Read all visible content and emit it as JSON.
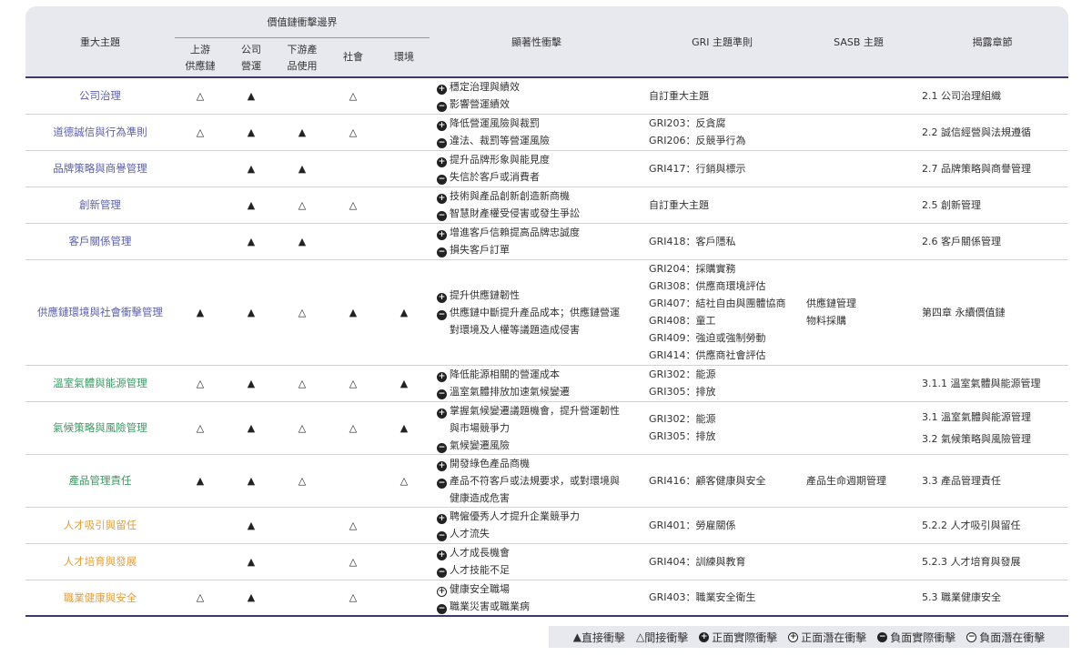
{
  "headers": {
    "topic": "重大主題",
    "value_chain": "價值鏈衝擊邊界",
    "upstream": [
      "上游",
      "供應鏈"
    ],
    "company": [
      "公司",
      "營運"
    ],
    "downstream": [
      "下游產",
      "品使用"
    ],
    "society": "社會",
    "environment": "環境",
    "impact": "顯著性衝擊",
    "gri": "GRI 主題準則",
    "sasb": "SASB 主題",
    "chapter": "揭露章節"
  },
  "colors": {
    "governance": "#5b5fa8",
    "environment": "#3a9a63",
    "social": "#e0a040",
    "rule": "#3a3a6a"
  },
  "rows": [
    {
      "topic": "公司治理",
      "cat": "gov",
      "up": "△",
      "co": "▲",
      "down": "",
      "soc": "△",
      "env": "",
      "impacts": [
        {
          "s": "+",
          "t": "穩定治理與績效"
        },
        {
          "s": "-",
          "t": "影響營運績效"
        }
      ],
      "gri": [
        "自訂重大主題"
      ],
      "sasb": [],
      "chapter": [
        "2.1 公司治理組織"
      ]
    },
    {
      "topic": "道德誠信與行為準則",
      "cat": "gov",
      "up": "△",
      "co": "▲",
      "down": "▲",
      "soc": "△",
      "env": "",
      "impacts": [
        {
          "s": "+",
          "t": "降低營運風險與裁罰"
        },
        {
          "s": "-",
          "t": "違法、裁罰等營運風險"
        }
      ],
      "gri": [
        "GRI203：反貪腐",
        "GRI206：反競爭行為"
      ],
      "sasb": [],
      "chapter": [
        "2.2 誠信經營與法規遵循"
      ]
    },
    {
      "topic": "品牌策略與商譽管理",
      "cat": "gov",
      "up": "",
      "co": "▲",
      "down": "▲",
      "soc": "",
      "env": "",
      "impacts": [
        {
          "s": "+",
          "t": "提升品牌形象與能見度"
        },
        {
          "s": "-",
          "t": "失信於客戶或消費者"
        }
      ],
      "gri": [
        "GRI417：行銷與標示"
      ],
      "sasb": [],
      "chapter": [
        "2.7 品牌策略與商譽管理"
      ]
    },
    {
      "topic": "創新管理",
      "cat": "gov",
      "up": "",
      "co": "▲",
      "down": "△",
      "soc": "△",
      "env": "",
      "impacts": [
        {
          "s": "+",
          "t": "技術與產品創新創造新商機"
        },
        {
          "s": "-",
          "t": "智慧財產權受侵害或發生爭訟"
        }
      ],
      "gri": [
        "自訂重大主題"
      ],
      "sasb": [],
      "chapter": [
        "2.5 創新管理"
      ]
    },
    {
      "topic": "客戶關係管理",
      "cat": "gov",
      "up": "",
      "co": "▲",
      "down": "▲",
      "soc": "",
      "env": "",
      "impacts": [
        {
          "s": "+",
          "t": "增進客戶信賴提高品牌忠誠度"
        },
        {
          "s": "-",
          "t": "損失客戶訂單"
        }
      ],
      "gri": [
        "GRI418：客戶隱私"
      ],
      "sasb": [],
      "chapter": [
        "2.6 客戶關係管理"
      ]
    },
    {
      "topic": "供應鏈環境與社會衝擊管理",
      "cat": "gov",
      "up": "▲",
      "co": "▲",
      "down": "△",
      "soc": "▲",
      "env": "▲",
      "impacts": [
        {
          "s": "+",
          "t": "提升供應鏈韌性"
        },
        {
          "s": "-",
          "t": "供應鏈中斷提升產品成本；供應鏈營運"
        },
        {
          "s": "",
          "t": "對環境及人權等議題造成侵害"
        }
      ],
      "gri": [
        "GRI204：採購實務",
        "GRI308：供應商環境評估",
        "GRI407：結社自由與團體協商",
        "GRI408：童工",
        "GRI409：強迫或強制勞動",
        "GRI414：供應商社會評估"
      ],
      "sasb": [
        "供應鏈管理",
        "物料採購"
      ],
      "chapter": [
        "第四章 永續價值鏈"
      ]
    },
    {
      "topic": "溫室氣體與能源管理",
      "cat": "env",
      "up": "△",
      "co": "▲",
      "down": "△",
      "soc": "△",
      "env": "▲",
      "impacts": [
        {
          "s": "+",
          "t": "降低能源相關的營運成本"
        },
        {
          "s": "-",
          "t": "溫室氣體排放加速氣候變遷"
        }
      ],
      "gri": [
        "GRI302：能源",
        "GRI305：排放"
      ],
      "sasb": [],
      "chapter": [
        "3.1.1 溫室氣體與能源管理"
      ]
    },
    {
      "topic": "氣候策略與風險管理",
      "cat": "env",
      "up": "△",
      "co": "▲",
      "down": "△",
      "soc": "△",
      "env": "▲",
      "impacts": [
        {
          "s": "+",
          "t": "掌握氣候變遷議題機會，提升營運韌性"
        },
        {
          "s": "",
          "t": "與市場競爭力"
        },
        {
          "s": "-",
          "t": "氣候變遷風險"
        }
      ],
      "gri": [
        "GRI302：能源",
        "GRI305：排放"
      ],
      "sasb": [],
      "chapter": [
        "3.1 溫室氣體與能源管理",
        "3.2 氣候策略與風險管理"
      ]
    },
    {
      "topic": "產品管理責任",
      "cat": "env",
      "up": "▲",
      "co": "▲",
      "down": "△",
      "soc": "",
      "env": "△",
      "impacts": [
        {
          "s": "+",
          "t": "開發綠色產品商機"
        },
        {
          "s": "-",
          "t": "產品不符客戶或法規要求，或對環境與"
        },
        {
          "s": "",
          "t": "健康造成危害"
        }
      ],
      "gri": [
        "GRI416：顧客健康與安全"
      ],
      "sasb": [
        "產品生命週期管理"
      ],
      "chapter": [
        "3.3 產品管理責任"
      ]
    },
    {
      "topic": "人才吸引與留任",
      "cat": "soc",
      "up": "",
      "co": "▲",
      "down": "",
      "soc": "△",
      "env": "",
      "impacts": [
        {
          "s": "+",
          "t": "聘僱優秀人才提升企業競爭力"
        },
        {
          "s": "-",
          "t": "人才流失"
        }
      ],
      "gri": [
        "GRI401：勞雇關係"
      ],
      "sasb": [],
      "chapter": [
        "5.2.2 人才吸引與留任"
      ]
    },
    {
      "topic": "人才培育與發展",
      "cat": "soc",
      "up": "",
      "co": "▲",
      "down": "",
      "soc": "△",
      "env": "",
      "impacts": [
        {
          "s": "+",
          "t": "人才成長機會"
        },
        {
          "s": "-",
          "t": "人才技能不足"
        }
      ],
      "gri": [
        "GRI404：訓練與教育"
      ],
      "sasb": [],
      "chapter": [
        "5.2.3 人才培育與發展"
      ]
    },
    {
      "topic": "職業健康與安全",
      "cat": "soc",
      "up": "△",
      "co": "▲",
      "down": "",
      "soc": "△",
      "env": "",
      "impacts": [
        {
          "s": "+o",
          "t": "健康安全職場"
        },
        {
          "s": "-",
          "t": "職業災害或職業病"
        }
      ],
      "gri": [
        "GRI403：職業安全衛生"
      ],
      "sasb": [],
      "chapter": [
        "5.3 職業健康安全"
      ]
    }
  ],
  "legend": [
    {
      "icon": "▲",
      "label": "直接衝擊"
    },
    {
      "icon": "△",
      "label": "間接衝擊"
    },
    {
      "icon": "+",
      "label": "正面實際衝擊"
    },
    {
      "icon": "+o",
      "label": "正面潛在衝擊"
    },
    {
      "icon": "-",
      "label": "負面實際衝擊"
    },
    {
      "icon": "-o",
      "label": "負面潛在衝擊"
    }
  ]
}
